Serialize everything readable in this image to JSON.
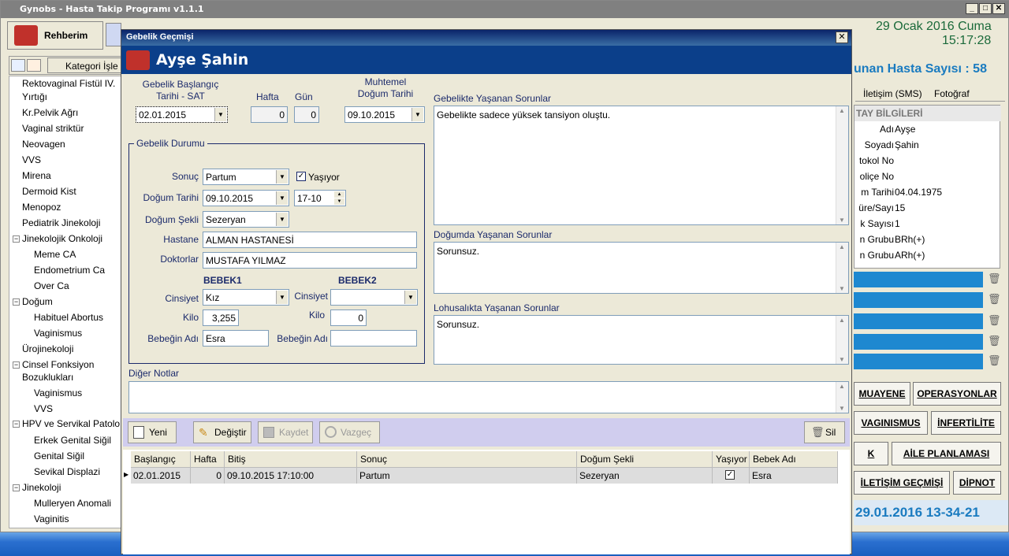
{
  "app": {
    "title": "Gynobs - Hasta Takip Programı v1.1.1",
    "date": "29 Ocak 2016 Cuma",
    "time": "15:17:28"
  },
  "left": {
    "tab": "Rehberim",
    "category_header": "Kategori İşle",
    "tree": [
      "Rektovaginal Fistül IV.",
      "Yırtığı",
      "Kr.Pelvik Ağrı",
      "Vaginal striktür",
      "Neovagen",
      "VVS",
      "Mirena",
      "Dermoid Kist",
      "Menopoz",
      "Pediatrik Jinekoloji",
      "Jinekolojik Onkoloji",
      "Meme CA",
      "Endometrium Ca",
      "Over Ca",
      "Doğum",
      "Habituel Abortus",
      "Vaginismus",
      "Ürojinekoloji",
      "Cinsel Fonksiyon",
      "Bozuklukları",
      "Vaginismus",
      "VVS",
      "HPV ve Servikal Patolo",
      "Erkek Genital Siğil",
      "Genital Siğil",
      "Sevikal Displazi",
      "Jinekoloji",
      "Mulleryen Anomali",
      "Vaginitis"
    ]
  },
  "right": {
    "patient_count": "unan Hasta Sayısı : 58",
    "tabs": [
      "İletişim (SMS)",
      "Fotoğraf"
    ],
    "info_header": "TAY BİLGİLERİ",
    "info": [
      {
        "k": "Adı",
        "v": "Ayşe"
      },
      {
        "k": "Soyadı",
        "v": "Şahin"
      },
      {
        "k": "tokol No",
        "v": ""
      },
      {
        "k": "oliçe No",
        "v": ""
      },
      {
        "k": "m Tarihi",
        "v": "04.04.1975"
      },
      {
        "k": "üre/Sayı",
        "v": "15"
      },
      {
        "k": "k Sayısı",
        "v": "1"
      },
      {
        "k": "n Grubu",
        "v": "BRh(+)"
      },
      {
        "k": "n Grubu",
        "v": "ARh(+)"
      }
    ],
    "buttons": {
      "muayene": "MUAYENE",
      "operasyonlar": "OPERASYONLAR",
      "vaginismus": "VAGINISMUS",
      "infertilite": "İNFERTİLİTE",
      "k": "K",
      "aile": "AİLE PLANLAMASI",
      "iletisim": "İLETİŞİM GEÇMİŞİ",
      "dipnot": "DİPNOT"
    },
    "footer_date": "29.01.2016 13-34-21"
  },
  "dialog": {
    "title": "Gebelik Geçmişi",
    "patient": "Ayşe Şahin",
    "start_label": "Gebelik Başlangıç\nTarihi - SAT",
    "start_value": "02.01.2015",
    "week_label": "Hafta",
    "week_value": "0",
    "day_label": "Gün",
    "day_value": "0",
    "due_label": "Muhtemel\nDoğum Tarihi",
    "due_value": "09.10.2015",
    "status_group": "Gebelik Durumu",
    "result_label": "Sonuç",
    "result_value": "Partum",
    "alive_label": "Yaşıyor",
    "birth_date_label": "Doğum Tarihi",
    "birth_date_value": "09.10.2015",
    "birth_time_value": "17-10",
    "birth_type_label": "Doğum Şekli",
    "birth_type_value": "Sezeryan",
    "hospital_label": "Hastane",
    "hospital_value": "ALMAN HASTANESİ",
    "doctors_label": "Doktorlar",
    "doctors_value": "MUSTAFA YILMAZ",
    "baby1": "BEBEK1",
    "baby2": "BEBEK2",
    "gender_label": "Cinsiyet",
    "gender1": "Kız",
    "gender2": "",
    "kilo_label": "Kilo",
    "kilo1": "3,255",
    "kilo2": "0",
    "name_label": "Bebeğin Adı",
    "name1": "Esra",
    "name2": "",
    "preg_issues_label": "Gebelikte Yaşanan Sorunlar",
    "preg_issues": "Gebelikte sadece yüksek tansiyon oluştu.",
    "birth_issues_label": "Doğumda Yaşanan Sorunlar",
    "birth_issues": "Sorunsuz.",
    "postpartum_label": "Lohusalıkta Yaşanan Sorunlar",
    "postpartum_issues": "Sorunsuz.",
    "notes_label": "Diğer Notlar",
    "notes": "",
    "toolbar": {
      "new": "Yeni",
      "edit": "Değiştir",
      "save": "Kaydet",
      "cancel": "Vazgeç",
      "delete": "Sil"
    },
    "grid": {
      "headers": [
        "Başlangıç",
        "Hafta",
        "Bitiş",
        "Sonuç",
        "Doğum Şekli",
        "Yaşıyor",
        "Bebek Adı"
      ],
      "row": [
        "02.01.2015",
        "0",
        "09.10.2015 17:10:00",
        "Partum",
        "Sezeryan",
        "",
        "Esra"
      ]
    }
  }
}
